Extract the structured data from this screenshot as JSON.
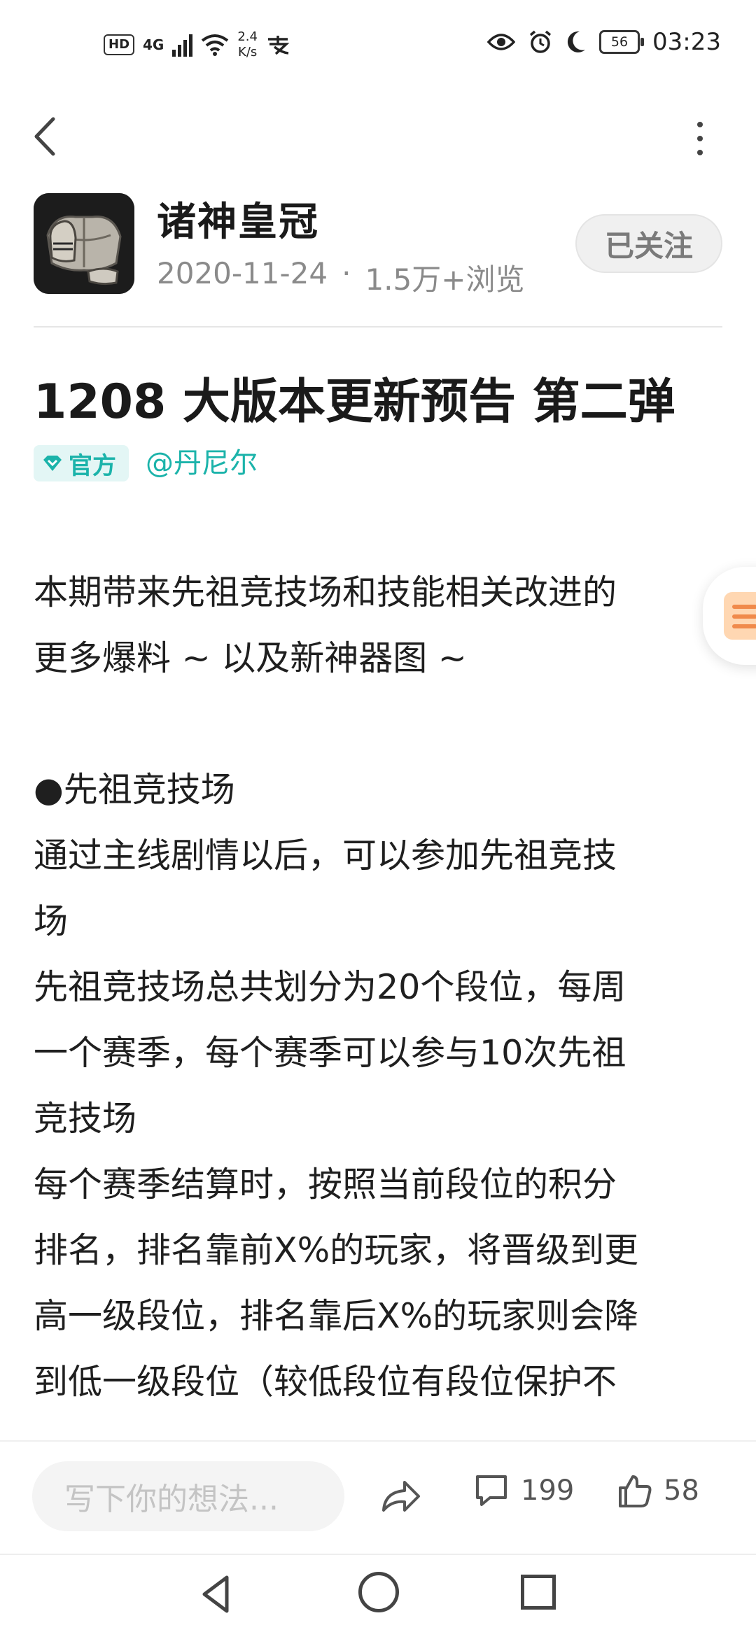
{
  "status_bar": {
    "hd": "HD",
    "signal": "4G",
    "speed_value": "2.4",
    "speed_unit": "K/s",
    "battery": "56",
    "time": "03:23"
  },
  "author": {
    "name": "诸神皇冠",
    "date": "2020-11-24",
    "separator": "·",
    "views": "1.5万+浏览",
    "follow_label": "已关注"
  },
  "post": {
    "title": "1208 大版本更新预告 第二弹",
    "official_badge": "官方",
    "mention": "@丹尼尔",
    "intro_line1": "本期带来先祖竞技场和技能相关改进的",
    "intro_line2": "更多爆料 ~ 以及新神器图 ~",
    "section_title": "●先祖竞技场",
    "para1_line1": "通过主线剧情以后，可以参加先祖竞技",
    "para1_line2": "场",
    "para2_line1": "先祖竞技场总共划分为20个段位，每周",
    "para2_line2": "一个赛季，每个赛季可以参与10次先祖",
    "para2_line3": "竞技场",
    "para3_line1": "每个赛季结算时，按照当前段位的积分",
    "para3_line2": "排名，排名靠前X%的玩家，将晋级到更",
    "para3_line3": "高一级段位，排名靠后X%的玩家则会降",
    "para3_line4": "到低一级段位（较低段位有段位保护不"
  },
  "actions": {
    "comment_placeholder": "写下你的想法...",
    "comment_count": "199",
    "like_count": "58"
  }
}
